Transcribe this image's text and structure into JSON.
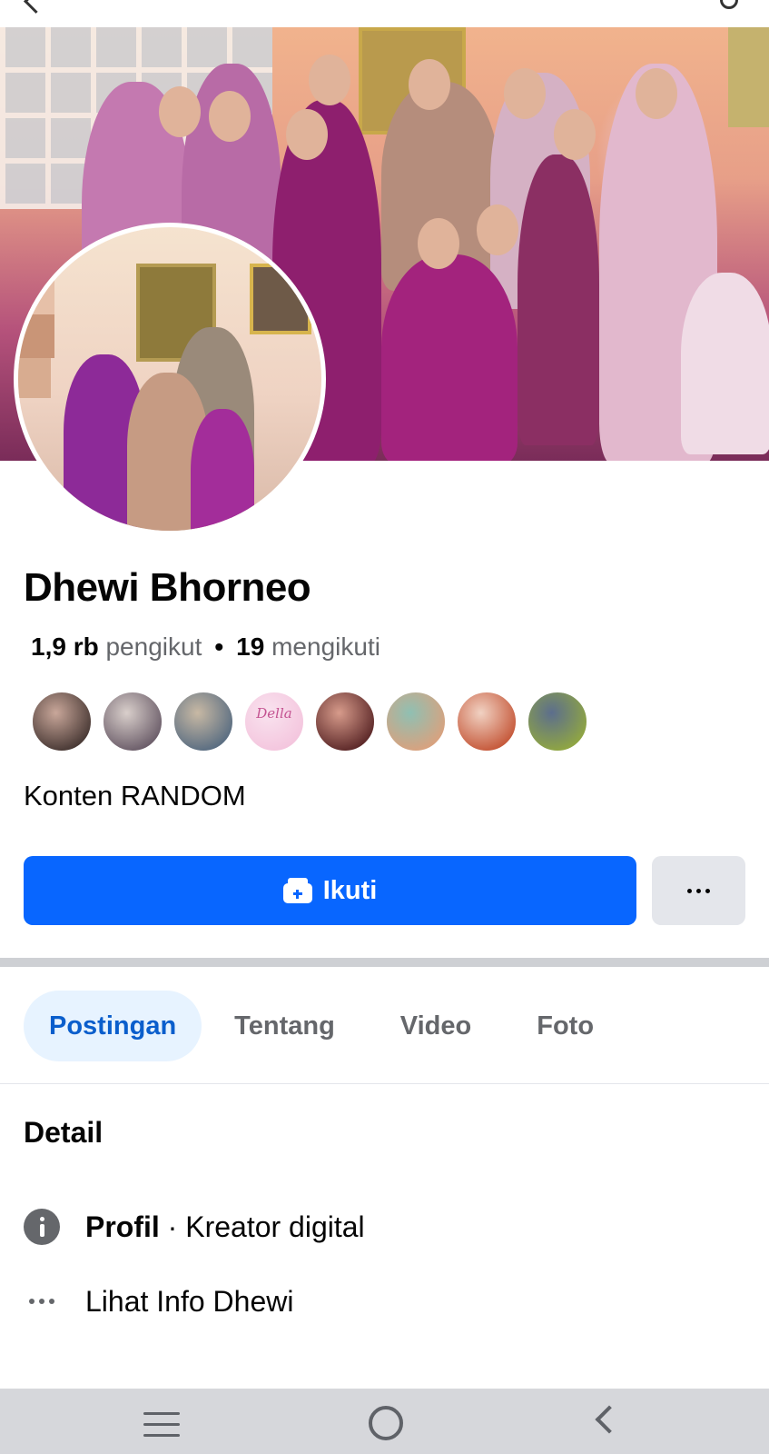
{
  "profile": {
    "name": "Dhewi Bhorneo",
    "followers_count": "1,9 rb",
    "followers_label": "pengikut",
    "separator": "•",
    "following_count": "19",
    "following_label": "mengikuti",
    "bio": "Konten RANDOM"
  },
  "friends": [
    {
      "color_a": "#4a3a36",
      "color_b": "#c9a79a"
    },
    {
      "color_a": "#6d5f6b",
      "color_b": "#d9cfcb"
    },
    {
      "color_a": "#5b6e82",
      "color_b": "#c8b9a4"
    },
    {
      "color_a": "#f4c6de",
      "color_b": "#f9e3ef",
      "label": "Della"
    },
    {
      "color_a": "#5e2a2a",
      "color_b": "#d79b8b"
    },
    {
      "color_a": "#d8a27f",
      "color_b": "#8fc0b3"
    },
    {
      "color_a": "#c65a3c",
      "color_b": "#f1d2c3"
    },
    {
      "color_a": "#8fa543",
      "color_b": "#5c6e8d"
    }
  ],
  "actions": {
    "follow_label": "Ikuti",
    "follow_icon": "follow-icon",
    "more_icon": "more-icon"
  },
  "tabs": [
    {
      "label": "Postingan",
      "active": true
    },
    {
      "label": "Tentang"
    },
    {
      "label": "Video"
    },
    {
      "label": "Foto"
    }
  ],
  "detail": {
    "title": "Detail",
    "profile_label": "Profil",
    "profile_value": " · Kreator digital",
    "info_link": "Lihat Info Dhewi"
  },
  "colors": {
    "accent": "#0866ff",
    "active_tab_bg": "#e7f3ff",
    "active_tab_text": "#0a5ecc"
  }
}
